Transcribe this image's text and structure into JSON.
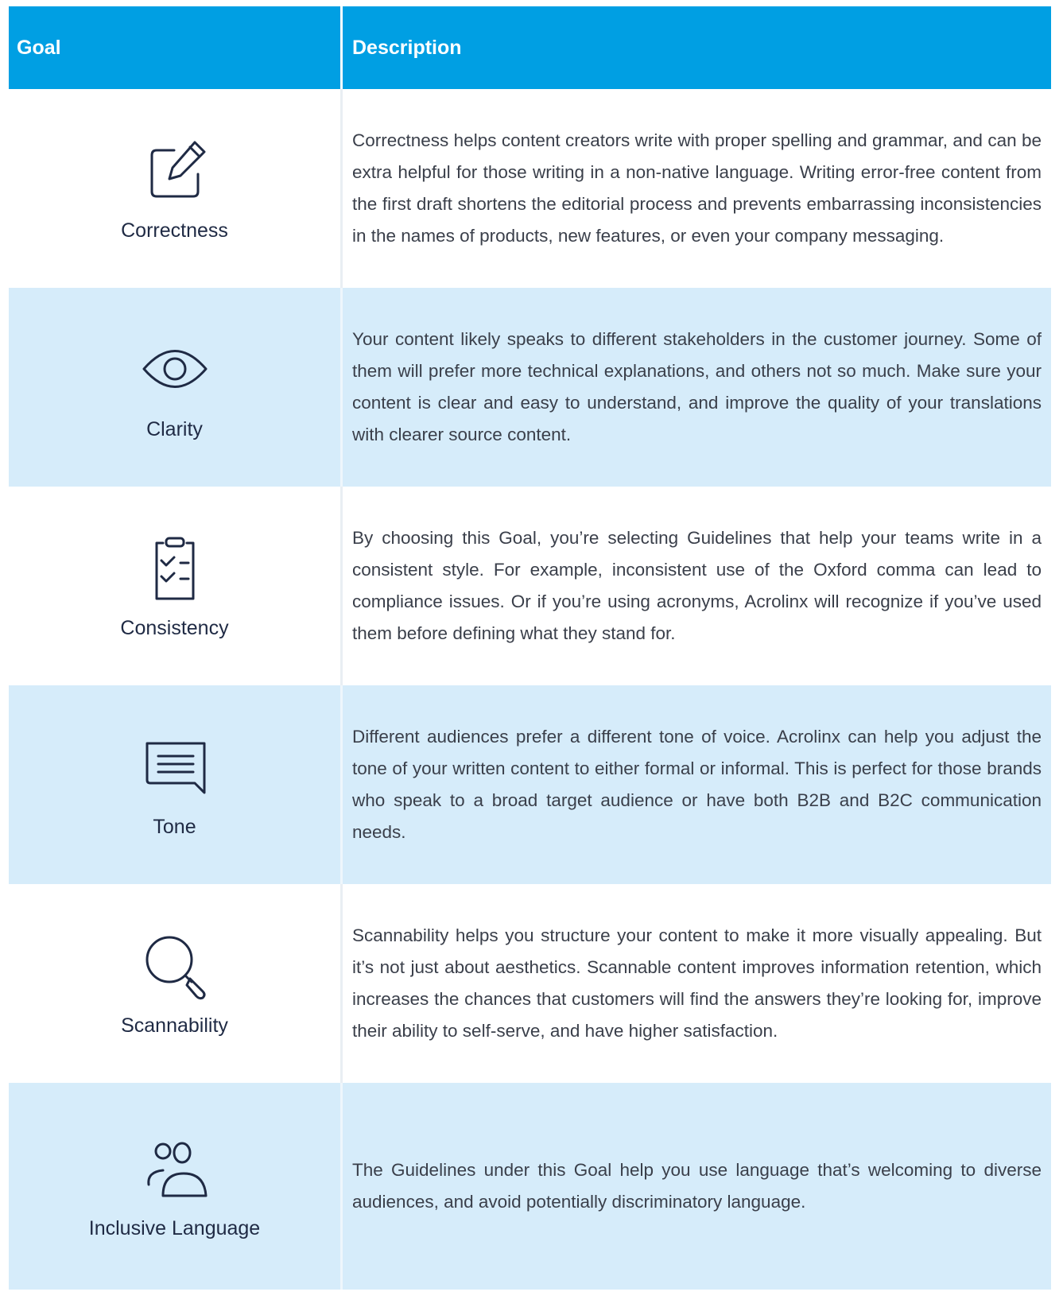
{
  "header": {
    "goal": "Goal",
    "description": "Description"
  },
  "colors": {
    "header": "#009fe3",
    "alt_row": "#d6ecfa",
    "icon": "#1f2a44"
  },
  "rows": [
    {
      "icon": "edit-icon",
      "goal": "Correctness",
      "description": "Correctness helps content creators write with proper spelling and grammar, and can be extra helpful for those writing in a non-native language. Writing error-free content from the first draft shortens the editorial process and prevents embarrassing inconsistencies in the names of products, new features, or even your company messaging."
    },
    {
      "icon": "eye-icon",
      "goal": "Clarity",
      "description": "Your content likely speaks to different stakeholders in the customer journey. Some of them will prefer more technical explanations, and others not so much. Make sure your content is clear and easy to understand, and improve the quality of your translations with clearer source content."
    },
    {
      "icon": "clipboard-checklist-icon",
      "goal": "Consistency",
      "description": "By choosing this Goal, you’re selecting Guidelines that help your teams write in a consistent style. For example, inconsistent use of the Oxford comma can lead to compliance issues. Or if you’re using acronyms, Acrolinx will recognize if you’ve used them before defining what they stand for."
    },
    {
      "icon": "chat-bubble-icon",
      "goal": "Tone",
      "description": "Different audiences prefer a different tone of voice. Acrolinx can help you adjust the tone of your written content to either formal or informal. This is perfect for those brands who speak to a broad target audience or have both B2B and B2C communication needs."
    },
    {
      "icon": "magnifier-icon",
      "goal": "Scannability",
      "description": "Scannability helps you structure your content to make it more visually appealing. But it’s not just about aesthetics. Scannable content improves information retention, which increases the chances that customers will find the answers they’re looking for, improve their ability to self-serve, and have higher satisfaction."
    },
    {
      "icon": "people-icon",
      "goal": "Inclusive Language",
      "description": "The Guidelines under this Goal help you use language that’s welcoming to diverse audiences, and avoid potentially discriminatory language."
    }
  ]
}
